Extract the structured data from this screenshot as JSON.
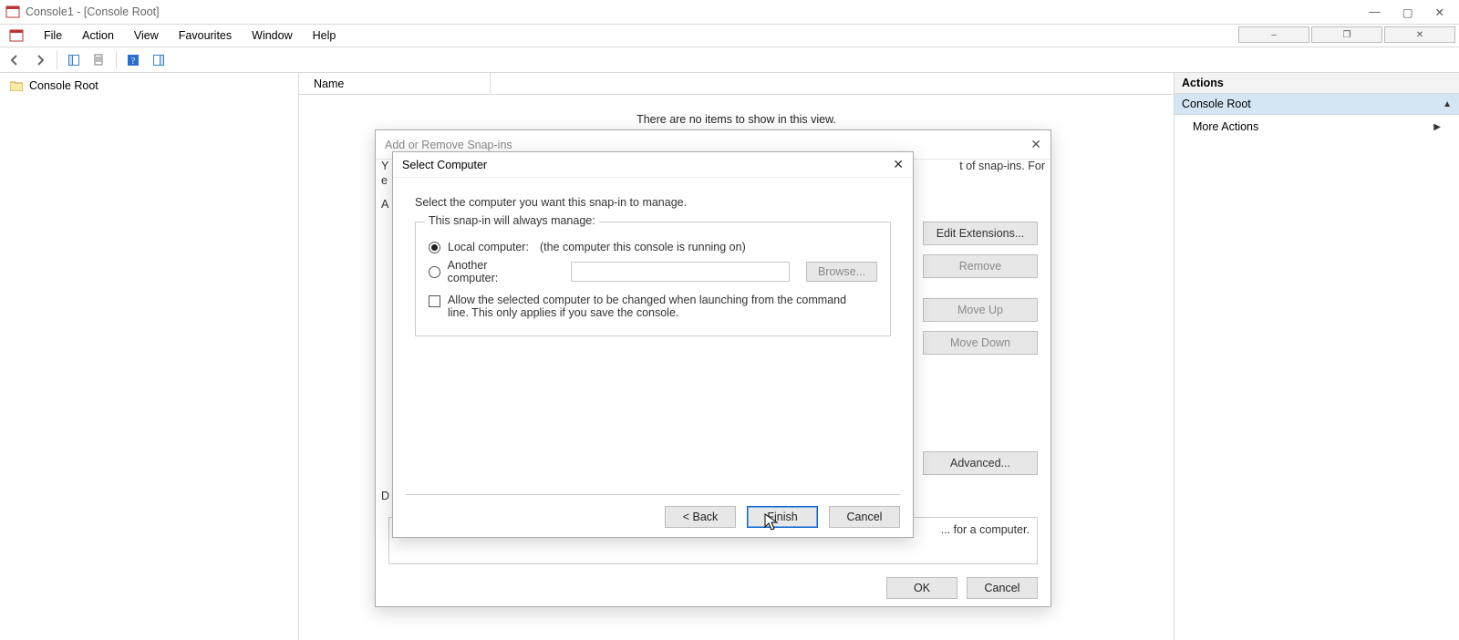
{
  "window": {
    "title": "Console1 - [Console Root]"
  },
  "menus": [
    "File",
    "Action",
    "View",
    "Favourites",
    "Window",
    "Help"
  ],
  "tree": {
    "root": "Console Root"
  },
  "list": {
    "col0": "Name",
    "empty": "There are no items to show in this view."
  },
  "actions": {
    "header": "Actions",
    "group": "Console Root",
    "more": "More Actions"
  },
  "outer": {
    "title": "Add or Remove Snap-ins",
    "intro1": "You can select snap-ins for this console from those available on your computer and configure the selected set of snap-ins. For",
    "intro2": "extensible snap-ins, you can configure which extensions are enabled.",
    "avail_lbl": "A",
    "desc_lbl": "D",
    "desc_text": "... for a computer.",
    "buttons": {
      "edit": "Edit Extensions...",
      "remove": "Remove",
      "moveup": "Move Up",
      "movedown": "Move Down",
      "advanced": "Advanced..."
    },
    "ok": "OK",
    "cancel": "Cancel"
  },
  "inner": {
    "title": "Select Computer",
    "prompt": "Select the computer you want this snap-in to manage.",
    "legend": "This snap-in will always manage:",
    "opt_local_label": "Local computer:",
    "opt_local_hint": "(the computer this console is running on)",
    "opt_other_label": "Another computer:",
    "browse": "Browse...",
    "allow_text": "Allow the selected computer to be changed when launching from the command line.  This only applies if you save the console.",
    "back": "< Back",
    "finish": "Finish",
    "cancel": "Cancel"
  }
}
